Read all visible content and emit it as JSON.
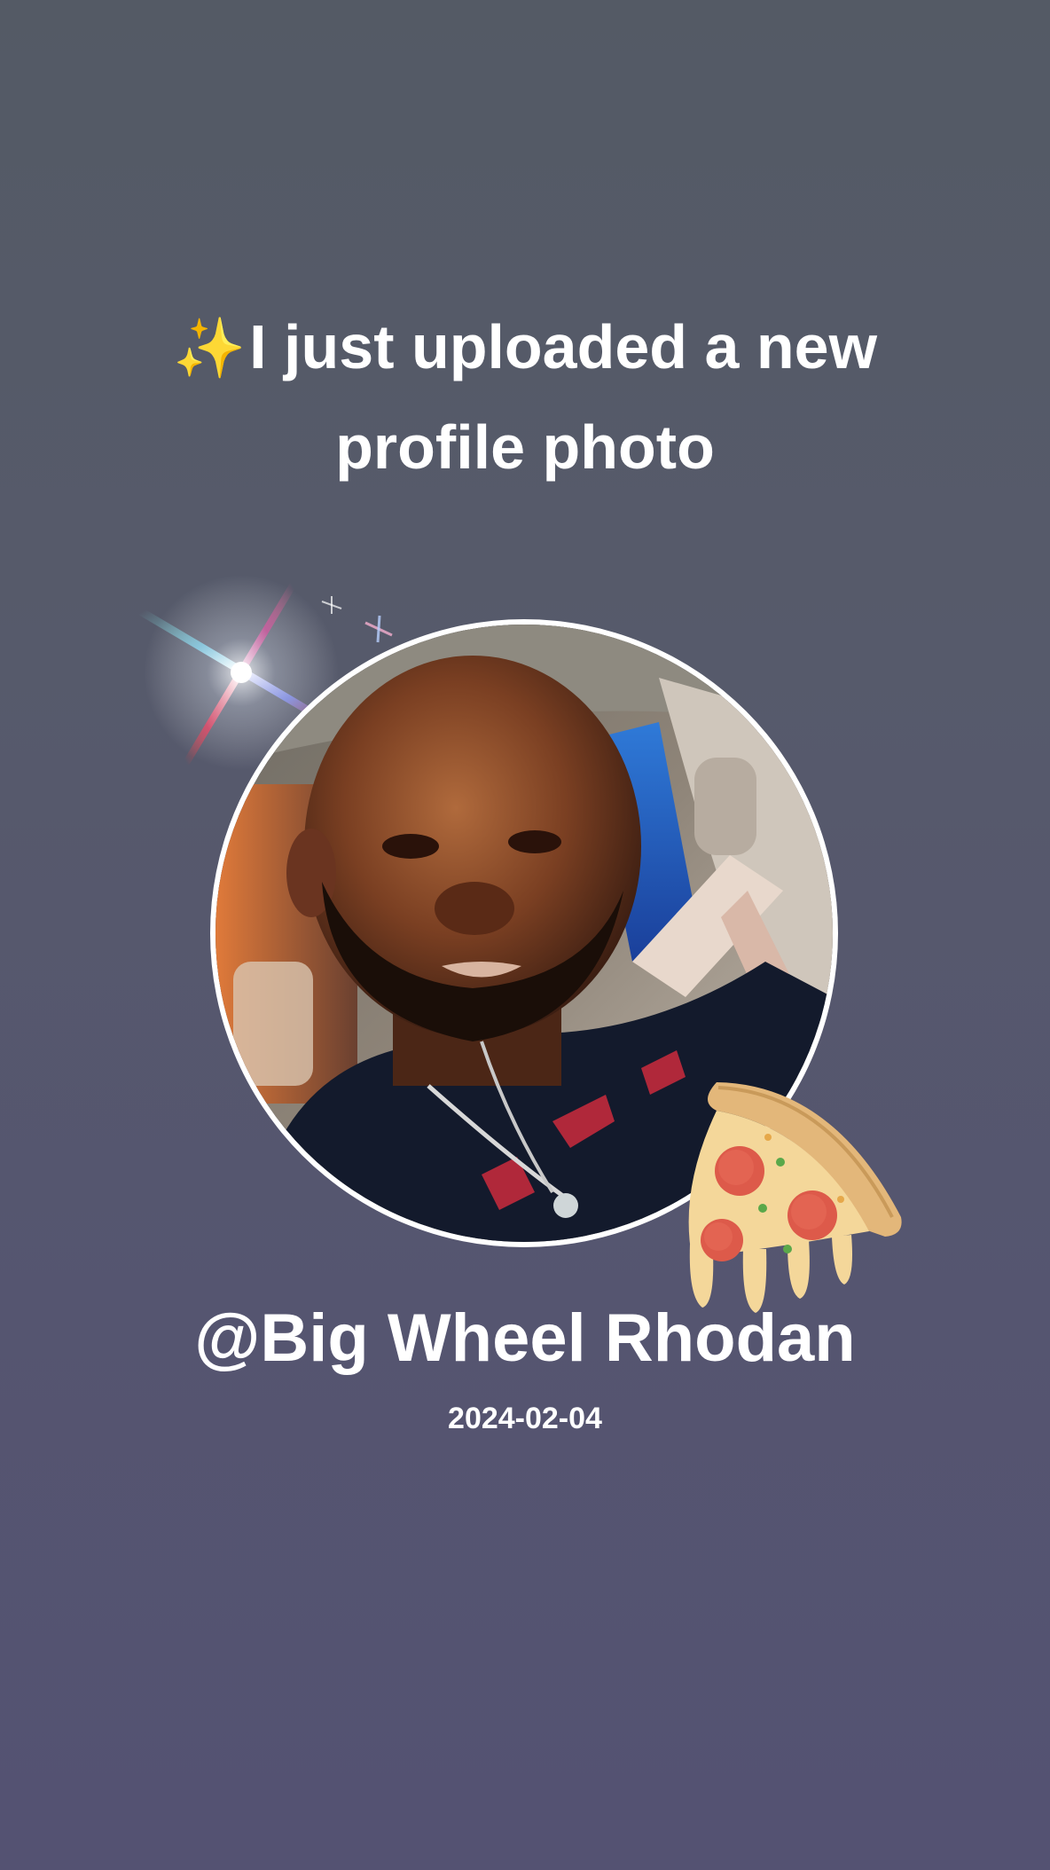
{
  "post": {
    "sparkle_icon": "✨",
    "headline": "I just uploaded a new profile photo",
    "username": "@Big Wheel Rhodan",
    "date": "2024-02-04"
  },
  "decorations": {
    "flare_icon": "sparkle-flare",
    "sticker_icon": "pizza-slice"
  },
  "colors": {
    "background_top": "#545a65",
    "background_bottom": "#545272",
    "text": "#ffffff",
    "avatar_ring": "#ffffff"
  }
}
